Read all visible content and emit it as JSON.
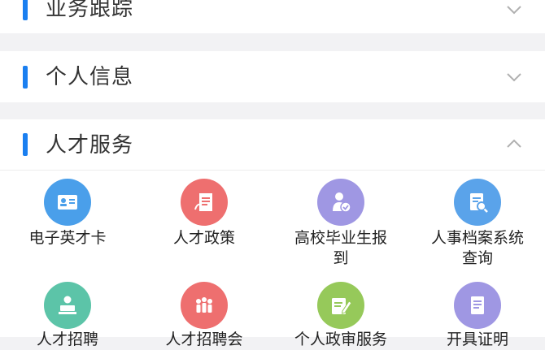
{
  "sections": [
    {
      "title": "业务跟踪",
      "state": "collapsed",
      "chevron_icon": "chevron-down-icon"
    },
    {
      "title": "个人信息",
      "state": "collapsed",
      "chevron_icon": "chevron-down-icon"
    },
    {
      "title": "人才服务",
      "state": "expanded",
      "chevron_icon": "chevron-up-icon"
    }
  ],
  "talent_services": [
    {
      "label": "电子英才卡",
      "icon": "id-card-icon",
      "color": "#4a9fea"
    },
    {
      "label": "人才政策",
      "icon": "policy-document-icon",
      "color": "#ee6f6f"
    },
    {
      "label": "高校毕业生报到",
      "label_line1": "高校毕业生报",
      "label_line2": "到",
      "icon": "graduate-checkin-icon",
      "color": "#9f97e3"
    },
    {
      "label": "人事档案系统查询",
      "label_line1": "人事档案系统",
      "label_line2": "查询",
      "icon": "archive-search-icon",
      "color": "#5aa3ea"
    },
    {
      "label": "人才招聘",
      "icon": "recruitment-icon",
      "color": "#5cc4a8"
    },
    {
      "label": "人才招聘会",
      "icon": "job-fair-icon",
      "color": "#ee6f6f"
    },
    {
      "label": "个人政审服务",
      "icon": "review-edit-icon",
      "color": "#96c95a"
    },
    {
      "label": "开具证明",
      "icon": "certificate-icon",
      "color": "#9f97e3"
    }
  ],
  "accent_color": "#1a7ff0"
}
